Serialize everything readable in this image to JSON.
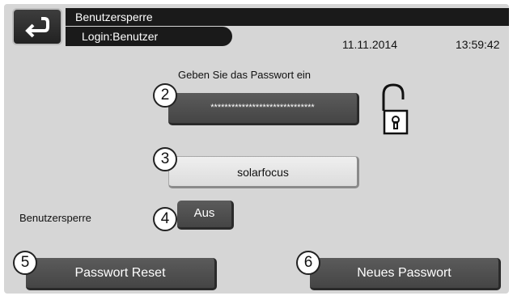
{
  "header": {
    "title": "Benutzersperre",
    "login_tab": "Login:Benutzer",
    "date": "11.11.2014",
    "time": "13:59:42",
    "back_icon": "return-arrow-icon"
  },
  "password": {
    "prompt": "Geben Sie das Passwort ein",
    "masked_value": "******************************",
    "lock_icon": "unlocked-padlock-icon",
    "callout": "2"
  },
  "user": {
    "value": "solarfocus",
    "callout": "3"
  },
  "user_lock": {
    "label": "Benutzersperre",
    "value": "Aus",
    "callout": "4"
  },
  "actions": {
    "reset_label": "Passwort Reset",
    "reset_callout": "5",
    "new_password_label": "Neues Passwort",
    "new_password_callout": "6"
  },
  "colors": {
    "background": "#d6d6d6",
    "header": "#1a1a1a",
    "dark_button": "#4f4f4f",
    "light_button": "#e6e6e6"
  }
}
